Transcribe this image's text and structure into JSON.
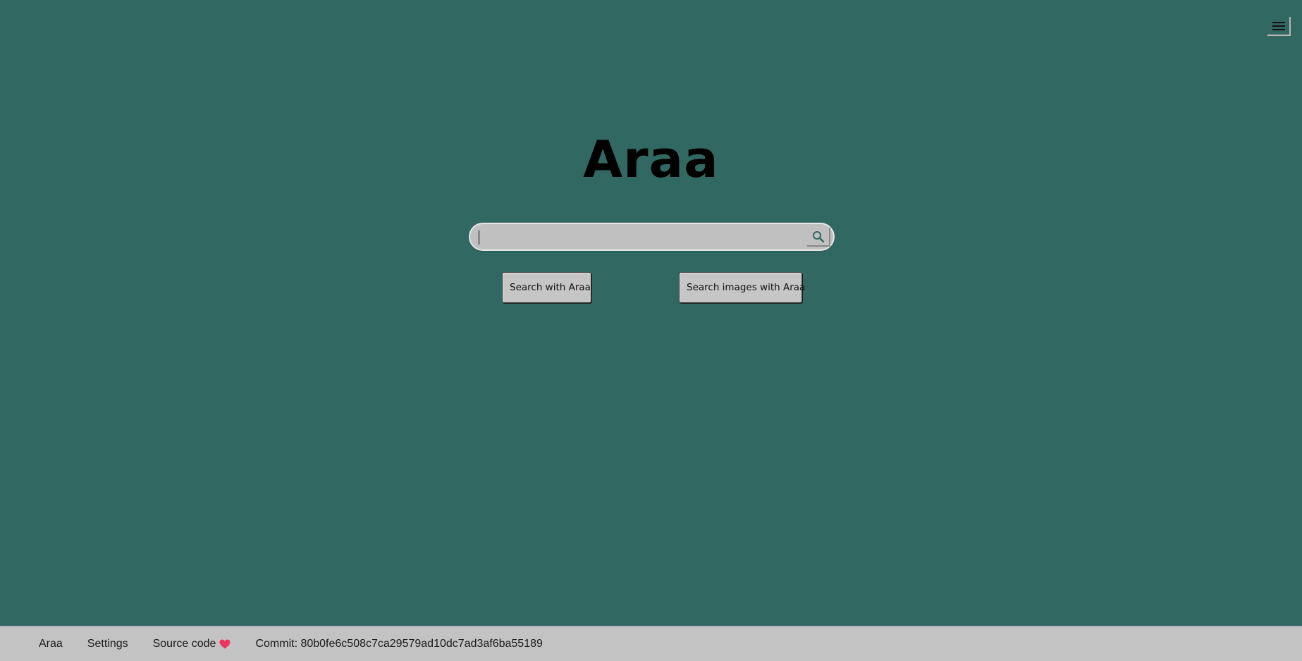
{
  "header": {
    "menu_icon": "hamburger-menu-icon"
  },
  "main": {
    "title": "Araa",
    "search": {
      "value": "",
      "placeholder": "",
      "submit_icon": "search-icon"
    },
    "buttons": {
      "search_label": "Search with Araa",
      "images_label": "Search images with Araa"
    }
  },
  "footer": {
    "links": [
      {
        "label": "Araa"
      },
      {
        "label": "Settings"
      },
      {
        "label": "Source code",
        "icon": "heart-icon"
      }
    ],
    "commit": "Commit: 80b0fe6c508c7ca29579ad10dc7ad3af6ba55189"
  },
  "colors": {
    "background": "#316862",
    "footer_background": "#c3c3c3",
    "heart": "#e8365d",
    "search_icon": "#316862"
  }
}
